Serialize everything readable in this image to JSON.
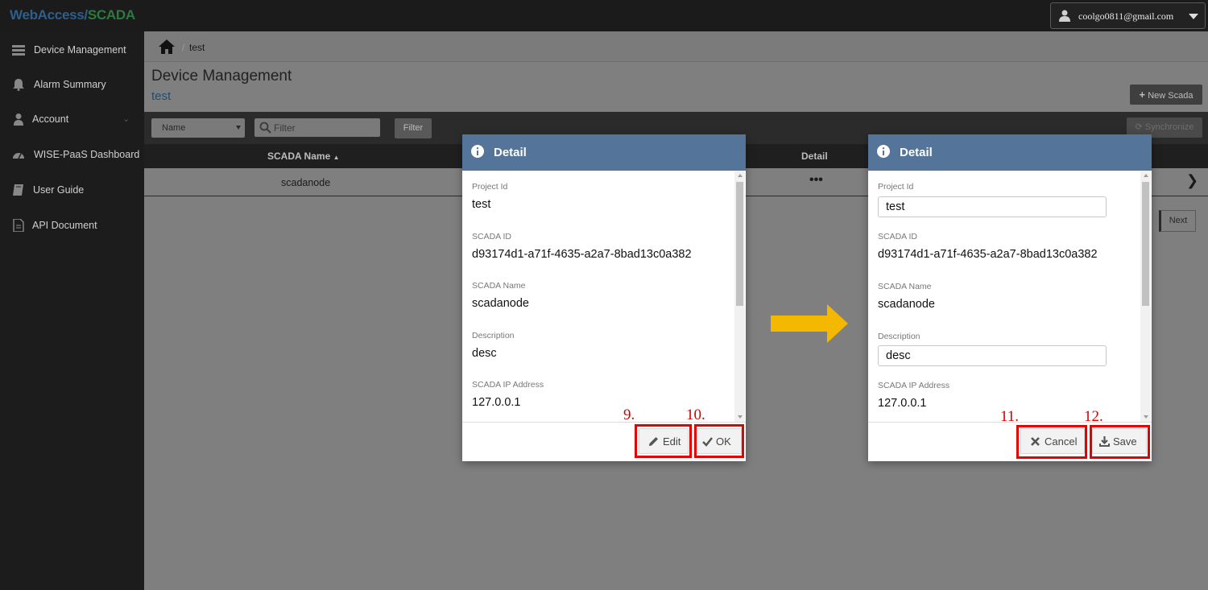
{
  "app": {
    "brand_part1": "WebAccess/",
    "brand_part2": "SCADA",
    "user_email": "coolgo0811@gmail.com"
  },
  "sidebar": {
    "items": [
      {
        "label": "Device Management",
        "icon": "server-icon"
      },
      {
        "label": "Alarm Summary",
        "icon": "bell-icon"
      },
      {
        "label": "Account",
        "icon": "user-icon"
      },
      {
        "label": "WISE-PaaS Dashboard",
        "icon": "dashboard-icon"
      },
      {
        "label": "User Guide",
        "icon": "book-icon"
      },
      {
        "label": "API Document",
        "icon": "document-icon"
      }
    ]
  },
  "breadcrumb": {
    "current": "test"
  },
  "page": {
    "title": "Device Management",
    "subtitle": "test",
    "new_button": "New Scada"
  },
  "filter": {
    "select_value": "Name",
    "input_placeholder": "Filter",
    "filter_button": "Filter",
    "sync_button": "Synchronize"
  },
  "table": {
    "col_name": "SCADA Name",
    "col_detail": "Detail",
    "rows": [
      {
        "name": "scadanode",
        "detail": "•••"
      }
    ]
  },
  "pagination": {
    "next": "Next"
  },
  "modal_view": {
    "title": "Detail",
    "fields": [
      {
        "label": "Project Id",
        "value": "test"
      },
      {
        "label": "SCADA ID",
        "value": "d93174d1-a71f-4635-a2a7-8bad13c0a382"
      },
      {
        "label": "SCADA Name",
        "value": "scadanode"
      },
      {
        "label": "Description",
        "value": "desc"
      },
      {
        "label": "SCADA IP Address",
        "value": "127.0.0.1"
      }
    ],
    "edit_button": "Edit",
    "ok_button": "OK",
    "step_edit": "9.",
    "step_ok": "10."
  },
  "modal_edit": {
    "title": "Detail",
    "fields": [
      {
        "label": "Project Id",
        "value": "test"
      },
      {
        "label": "SCADA ID",
        "value": "d93174d1-a71f-4635-a2a7-8bad13c0a382"
      },
      {
        "label": "SCADA Name",
        "value": "scadanode"
      },
      {
        "label": "Description",
        "value": "desc"
      },
      {
        "label": "SCADA IP Address",
        "value": "127.0.0.1"
      }
    ],
    "cancel_button": "Cancel",
    "save_button": "Save",
    "step_cancel": "11.",
    "step_save": "12."
  },
  "colors": {
    "modal_header": "#557499",
    "highlight": "#e60000",
    "arrow": "#f5b800",
    "step_number": "#d40000"
  }
}
